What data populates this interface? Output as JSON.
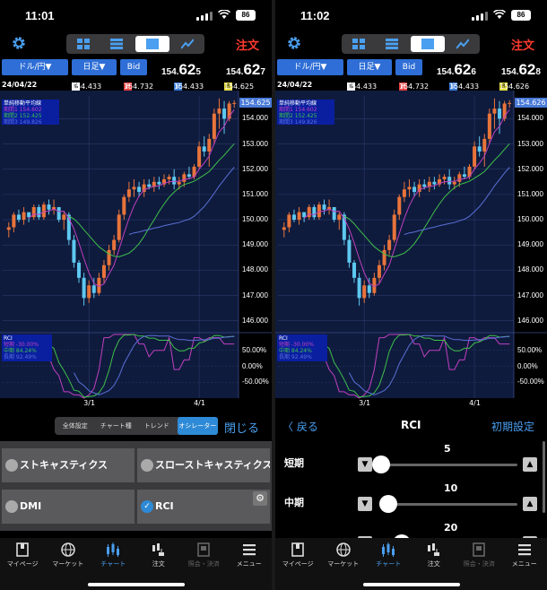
{
  "colors": {
    "accent": "#4a9ff0",
    "order": "#ff3b30",
    "button": "#2e6ed6",
    "chart_bg": "#0f1b3d",
    "up": "#e8743b",
    "down": "#5ec8f0",
    "ma1": "#c040c0",
    "ma2": "#3fc04a",
    "ma3": "#5a70d8",
    "rci_short": "#c040c0",
    "rci_mid": "#3fc04a",
    "rci_long": "#5a70d8"
  },
  "left": {
    "status": {
      "time": "11:01",
      "battery": "86"
    },
    "order_label": "注文",
    "pair_label": "ドル/円▼",
    "period_label": "日足▼",
    "side_label": "Bid",
    "bid": {
      "head": "154.",
      "big": "62",
      "tail": "5"
    },
    "ask": {
      "head": "154.",
      "big": "62",
      "tail": "7"
    },
    "date": "24/04/22",
    "ohlc": {
      "o": "154.433",
      "h": "154.732",
      "l": "154.433",
      "c": "154.625"
    },
    "current_price": "154.625",
    "ma_legend": {
      "title": "単純移動平均線",
      "rows": [
        "期間1  154.602",
        "期間2  152.425",
        "期間3  149.826"
      ]
    },
    "rci_legend": {
      "title": "RCI",
      "rows": [
        "短期  -30.00%",
        "中期  84.24%",
        "長期  92.49%"
      ]
    },
    "tabs": [
      "全体設定",
      "チャート種",
      "トレンド",
      "オシレーター"
    ],
    "close_label": "閉じる",
    "indicators": [
      {
        "label": "ストキャスティクス",
        "checked": false
      },
      {
        "label": "スローストキャスティクス",
        "checked": false
      },
      {
        "label": "DMI",
        "checked": false
      },
      {
        "label": "RCI",
        "checked": true
      }
    ]
  },
  "right": {
    "status": {
      "time": "11:02",
      "battery": "86"
    },
    "order_label": "注文",
    "pair_label": "ドル/円▼",
    "period_label": "日足▼",
    "side_label": "Bid",
    "bid": {
      "head": "154.",
      "big": "62",
      "tail": "6"
    },
    "ask": {
      "head": "154.",
      "big": "62",
      "tail": "8"
    },
    "date": "24/04/22",
    "ohlc": {
      "o": "154.433",
      "h": "154.732",
      "l": "154.433",
      "c": "154.626"
    },
    "current_price": "154.626",
    "ma_legend": {
      "title": "単純移動平均線",
      "rows": [
        "期間1  154.602",
        "期間2  152.425",
        "期間3  149.826"
      ]
    },
    "rci_legend": {
      "title": "RCI",
      "rows": [
        "短期  -30.00%",
        "中期  84.24%",
        "長期  92.49%"
      ]
    },
    "back_label": "戻る",
    "panel_title": "RCI",
    "reset_label": "初期設定",
    "params": [
      {
        "label": "短期",
        "value": "5",
        "fraction": 0.0
      },
      {
        "label": "中期",
        "value": "10",
        "fraction": 0.05
      },
      {
        "label": "",
        "value": "20",
        "fraction": 0.15
      }
    ]
  },
  "ohlc_tags": {
    "o": "始",
    "h": "高",
    "l": "安",
    "c": "終"
  },
  "chart_axis": {
    "price_ticks": [
      "154.000",
      "153.000",
      "152.000",
      "151.000",
      "150.000",
      "149.000",
      "148.000",
      "147.000",
      "146.000"
    ],
    "rci_ticks": [
      "50.00%",
      "0.00%",
      "-50.00%"
    ],
    "x_ticks": [
      "3/1",
      "4/1"
    ]
  },
  "nav": [
    {
      "label": "マイページ",
      "icon": "book-icon",
      "state": "normal"
    },
    {
      "label": "マーケット",
      "icon": "globe-icon",
      "state": "normal"
    },
    {
      "label": "チャート",
      "icon": "candles-icon",
      "state": "on"
    },
    {
      "label": "注文",
      "icon": "order-icon",
      "state": "normal"
    },
    {
      "label": "照会・決済",
      "icon": "ledger-icon",
      "state": "dis"
    },
    {
      "label": "メニュー",
      "icon": "menu-icon",
      "state": "normal"
    }
  ],
  "chart_data": {
    "type": "candlestick",
    "series_price": [
      [
        149.6,
        149.9,
        149.3,
        149.7
      ],
      [
        149.7,
        150.3,
        149.5,
        150.2
      ],
      [
        150.2,
        150.4,
        149.9,
        150.0
      ],
      [
        150.0,
        150.5,
        149.8,
        150.3
      ],
      [
        150.3,
        150.2,
        149.9,
        150.1
      ],
      [
        150.1,
        150.6,
        150.0,
        150.5
      ],
      [
        150.5,
        150.6,
        150.0,
        150.1
      ],
      [
        150.1,
        150.7,
        150.0,
        150.6
      ],
      [
        150.6,
        150.8,
        150.2,
        150.4
      ],
      [
        150.4,
        150.8,
        150.2,
        150.5
      ],
      [
        150.5,
        150.4,
        149.9,
        150.0
      ],
      [
        150.0,
        150.3,
        149.6,
        150.2
      ],
      [
        150.2,
        150.3,
        149.0,
        149.2
      ],
      [
        149.2,
        149.4,
        148.1,
        148.3
      ],
      [
        148.3,
        148.4,
        147.5,
        147.7
      ],
      [
        147.7,
        147.9,
        146.6,
        146.9
      ],
      [
        146.9,
        147.6,
        146.7,
        147.4
      ],
      [
        147.4,
        147.7,
        146.9,
        147.1
      ],
      [
        147.1,
        147.9,
        147.0,
        147.7
      ],
      [
        147.7,
        148.4,
        147.5,
        148.2
      ],
      [
        148.2,
        149.0,
        148.0,
        148.8
      ],
      [
        148.8,
        149.4,
        148.6,
        149.2
      ],
      [
        149.2,
        150.4,
        149.1,
        150.2
      ],
      [
        150.2,
        151.0,
        150.0,
        150.9
      ],
      [
        150.9,
        151.5,
        150.7,
        151.2
      ],
      [
        151.2,
        151.6,
        150.9,
        151.3
      ],
      [
        151.3,
        151.5,
        150.9,
        151.1
      ],
      [
        151.1,
        151.6,
        150.9,
        151.4
      ],
      [
        151.4,
        151.6,
        151.2,
        151.3
      ],
      [
        151.3,
        151.7,
        151.1,
        151.5
      ],
      [
        151.5,
        151.7,
        151.2,
        151.4
      ],
      [
        151.4,
        151.8,
        151.3,
        151.6
      ],
      [
        151.6,
        151.8,
        151.4,
        151.7
      ],
      [
        151.7,
        152.0,
        151.2,
        151.4
      ],
      [
        151.4,
        151.7,
        151.2,
        151.5
      ],
      [
        151.5,
        151.9,
        151.3,
        151.8
      ],
      [
        151.8,
        152.1,
        151.6,
        151.7
      ],
      [
        151.7,
        152.2,
        151.6,
        152.1
      ],
      [
        152.1,
        153.1,
        152.0,
        152.9
      ],
      [
        152.9,
        153.3,
        152.5,
        152.7
      ],
      [
        152.7,
        153.4,
        152.1,
        153.2
      ],
      [
        153.2,
        154.4,
        153.0,
        154.2
      ],
      [
        154.2,
        154.8,
        153.6,
        154.4
      ],
      [
        154.4,
        154.7,
        153.4,
        154.0
      ],
      [
        154.0,
        154.7,
        153.9,
        154.6
      ],
      [
        154.6,
        154.73,
        154.43,
        154.62
      ]
    ]
  }
}
